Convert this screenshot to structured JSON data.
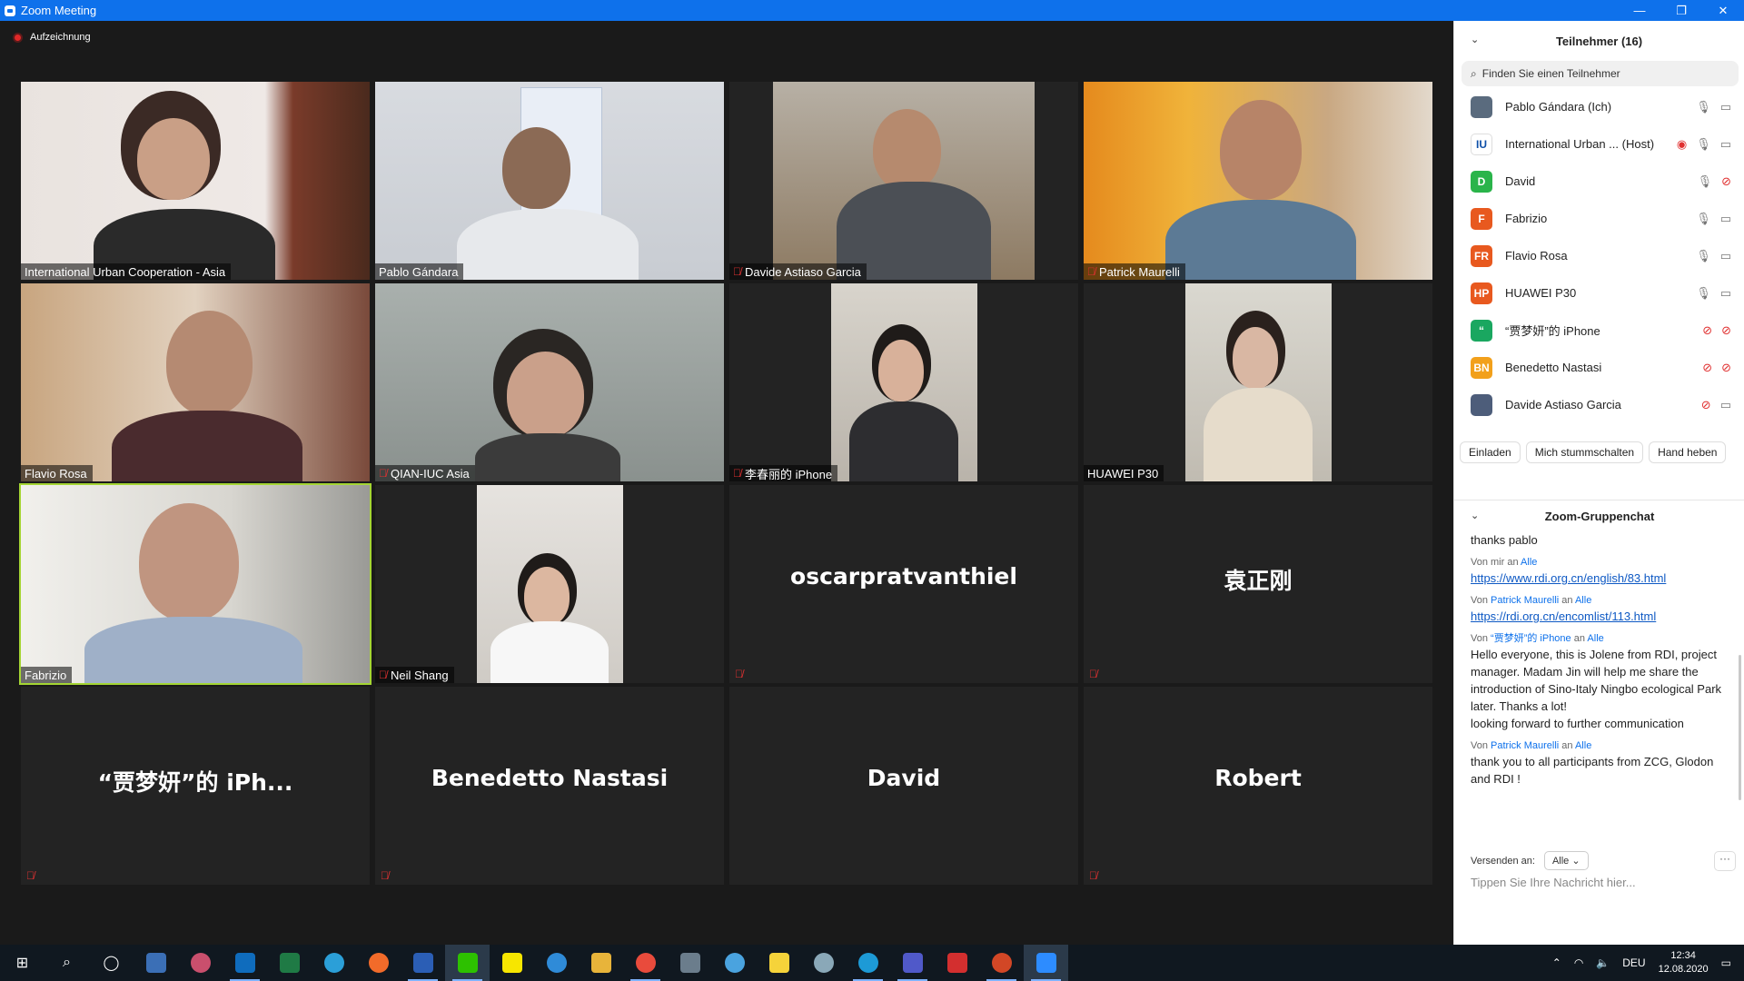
{
  "window": {
    "title": "Zoom Meeting",
    "minimize": "—",
    "restore": "❐",
    "close": "✕"
  },
  "recording": {
    "label": "Aufzeichnung"
  },
  "tiles": [
    {
      "name": "International Urban Cooperation - Asia",
      "muted": false
    },
    {
      "name": "Pablo Gándara",
      "muted": false
    },
    {
      "name": "Davide Astiaso Garcia",
      "muted": true
    },
    {
      "name": "Patrick Maurelli",
      "muted": true
    },
    {
      "name": "Flavio Rosa",
      "muted": false
    },
    {
      "name": "QIAN-IUC Asia",
      "muted": true
    },
    {
      "name": "李春丽的 iPhone",
      "muted": true
    },
    {
      "name": "HUAWEI P30",
      "muted": false
    },
    {
      "name": "Fabrizio",
      "muted": false
    },
    {
      "name": "Neil Shang",
      "muted": true
    },
    {
      "name": "oscarpratvanthiel",
      "muted": true
    },
    {
      "name": "袁正刚",
      "muted": true
    },
    {
      "name": "“贾梦妍”的 iPh...",
      "muted": true
    },
    {
      "name": "Benedetto Nastasi",
      "muted": true
    },
    {
      "name": "David",
      "muted": false
    },
    {
      "name": "Robert",
      "muted": true
    }
  ],
  "participants_panel": {
    "title": "Teilnehmer (16)",
    "search_placeholder": "Finden Sie einen Teilnehmer",
    "list": [
      {
        "name": "Pablo Gándara (Ich)",
        "initials": "",
        "color": "#5a6b7e",
        "mic": "on",
        "cam": "on"
      },
      {
        "name": "International Urban ...  (Host)",
        "initials": "IU",
        "color": "#ffffff",
        "mic": "on",
        "cam": "on"
      },
      {
        "name": "David",
        "initials": "D",
        "color": "#2ab44a",
        "mic": "on",
        "cam": "off"
      },
      {
        "name": "Fabrizio",
        "initials": "F",
        "color": "#e8591f",
        "mic": "on",
        "cam": "on"
      },
      {
        "name": "Flavio Rosa",
        "initials": "FR",
        "color": "#e8591f",
        "mic": "on",
        "cam": "on"
      },
      {
        "name": "HUAWEI P30",
        "initials": "HP",
        "color": "#e8591f",
        "mic": "on",
        "cam": "on"
      },
      {
        "name": "“贾梦妍”的 iPhone",
        "initials": "“",
        "color": "#1aa760",
        "mic": "off",
        "cam": "off"
      },
      {
        "name": "Benedetto Nastasi",
        "initials": "BN",
        "color": "#f2a01b",
        "mic": "off",
        "cam": "off"
      },
      {
        "name": "Davide Astiaso Garcia",
        "initials": "",
        "color": "#4d5d7a",
        "mic": "off",
        "cam": "on"
      }
    ],
    "buttons": {
      "invite": "Einladen",
      "mute_me": "Mich stummschalten",
      "raise_hand": "Hand heben"
    }
  },
  "chat": {
    "title": "Zoom-Gruppenchat",
    "messages": [
      {
        "from": "",
        "to": "",
        "text": "thanks pablo",
        "link": false
      },
      {
        "from": "Von mir an ",
        "to": "Alle",
        "text": "https://www.rdi.org.cn/english/83.html",
        "link": true
      },
      {
        "from_prefix": "Von ",
        "from": "Patrick Maurelli",
        "mid": " an ",
        "to": "Alle",
        "text": "https://rdi.org.cn/encomlist/113.html",
        "link": true
      },
      {
        "from_prefix": "Von ",
        "from": "“贾梦妍”的 iPhone",
        "mid": " an ",
        "to": "Alle",
        "text": "Hello everyone, this is Jolene from RDI, project manager. Madam Jin will help me share the introduction of Sino-Italy Ningbo ecological Park later. Thanks a lot!",
        "link": false
      },
      {
        "from": "",
        "to": "",
        "text": "looking forward to further communication",
        "link": false
      },
      {
        "from_prefix": "Von ",
        "from": "Patrick Maurelli",
        "mid": " an ",
        "to": "Alle",
        "text": "thank you to all participants from ZCG, Glodon and RDI !",
        "link": false
      }
    ],
    "send_to_label": "Versenden an:",
    "send_to_value": "Alle",
    "input_placeholder": "Tippen Sie Ihre Nachricht hier..."
  },
  "taskbar": {
    "lang": "DEU",
    "time": "12:34",
    "date": "12.08.2020"
  }
}
